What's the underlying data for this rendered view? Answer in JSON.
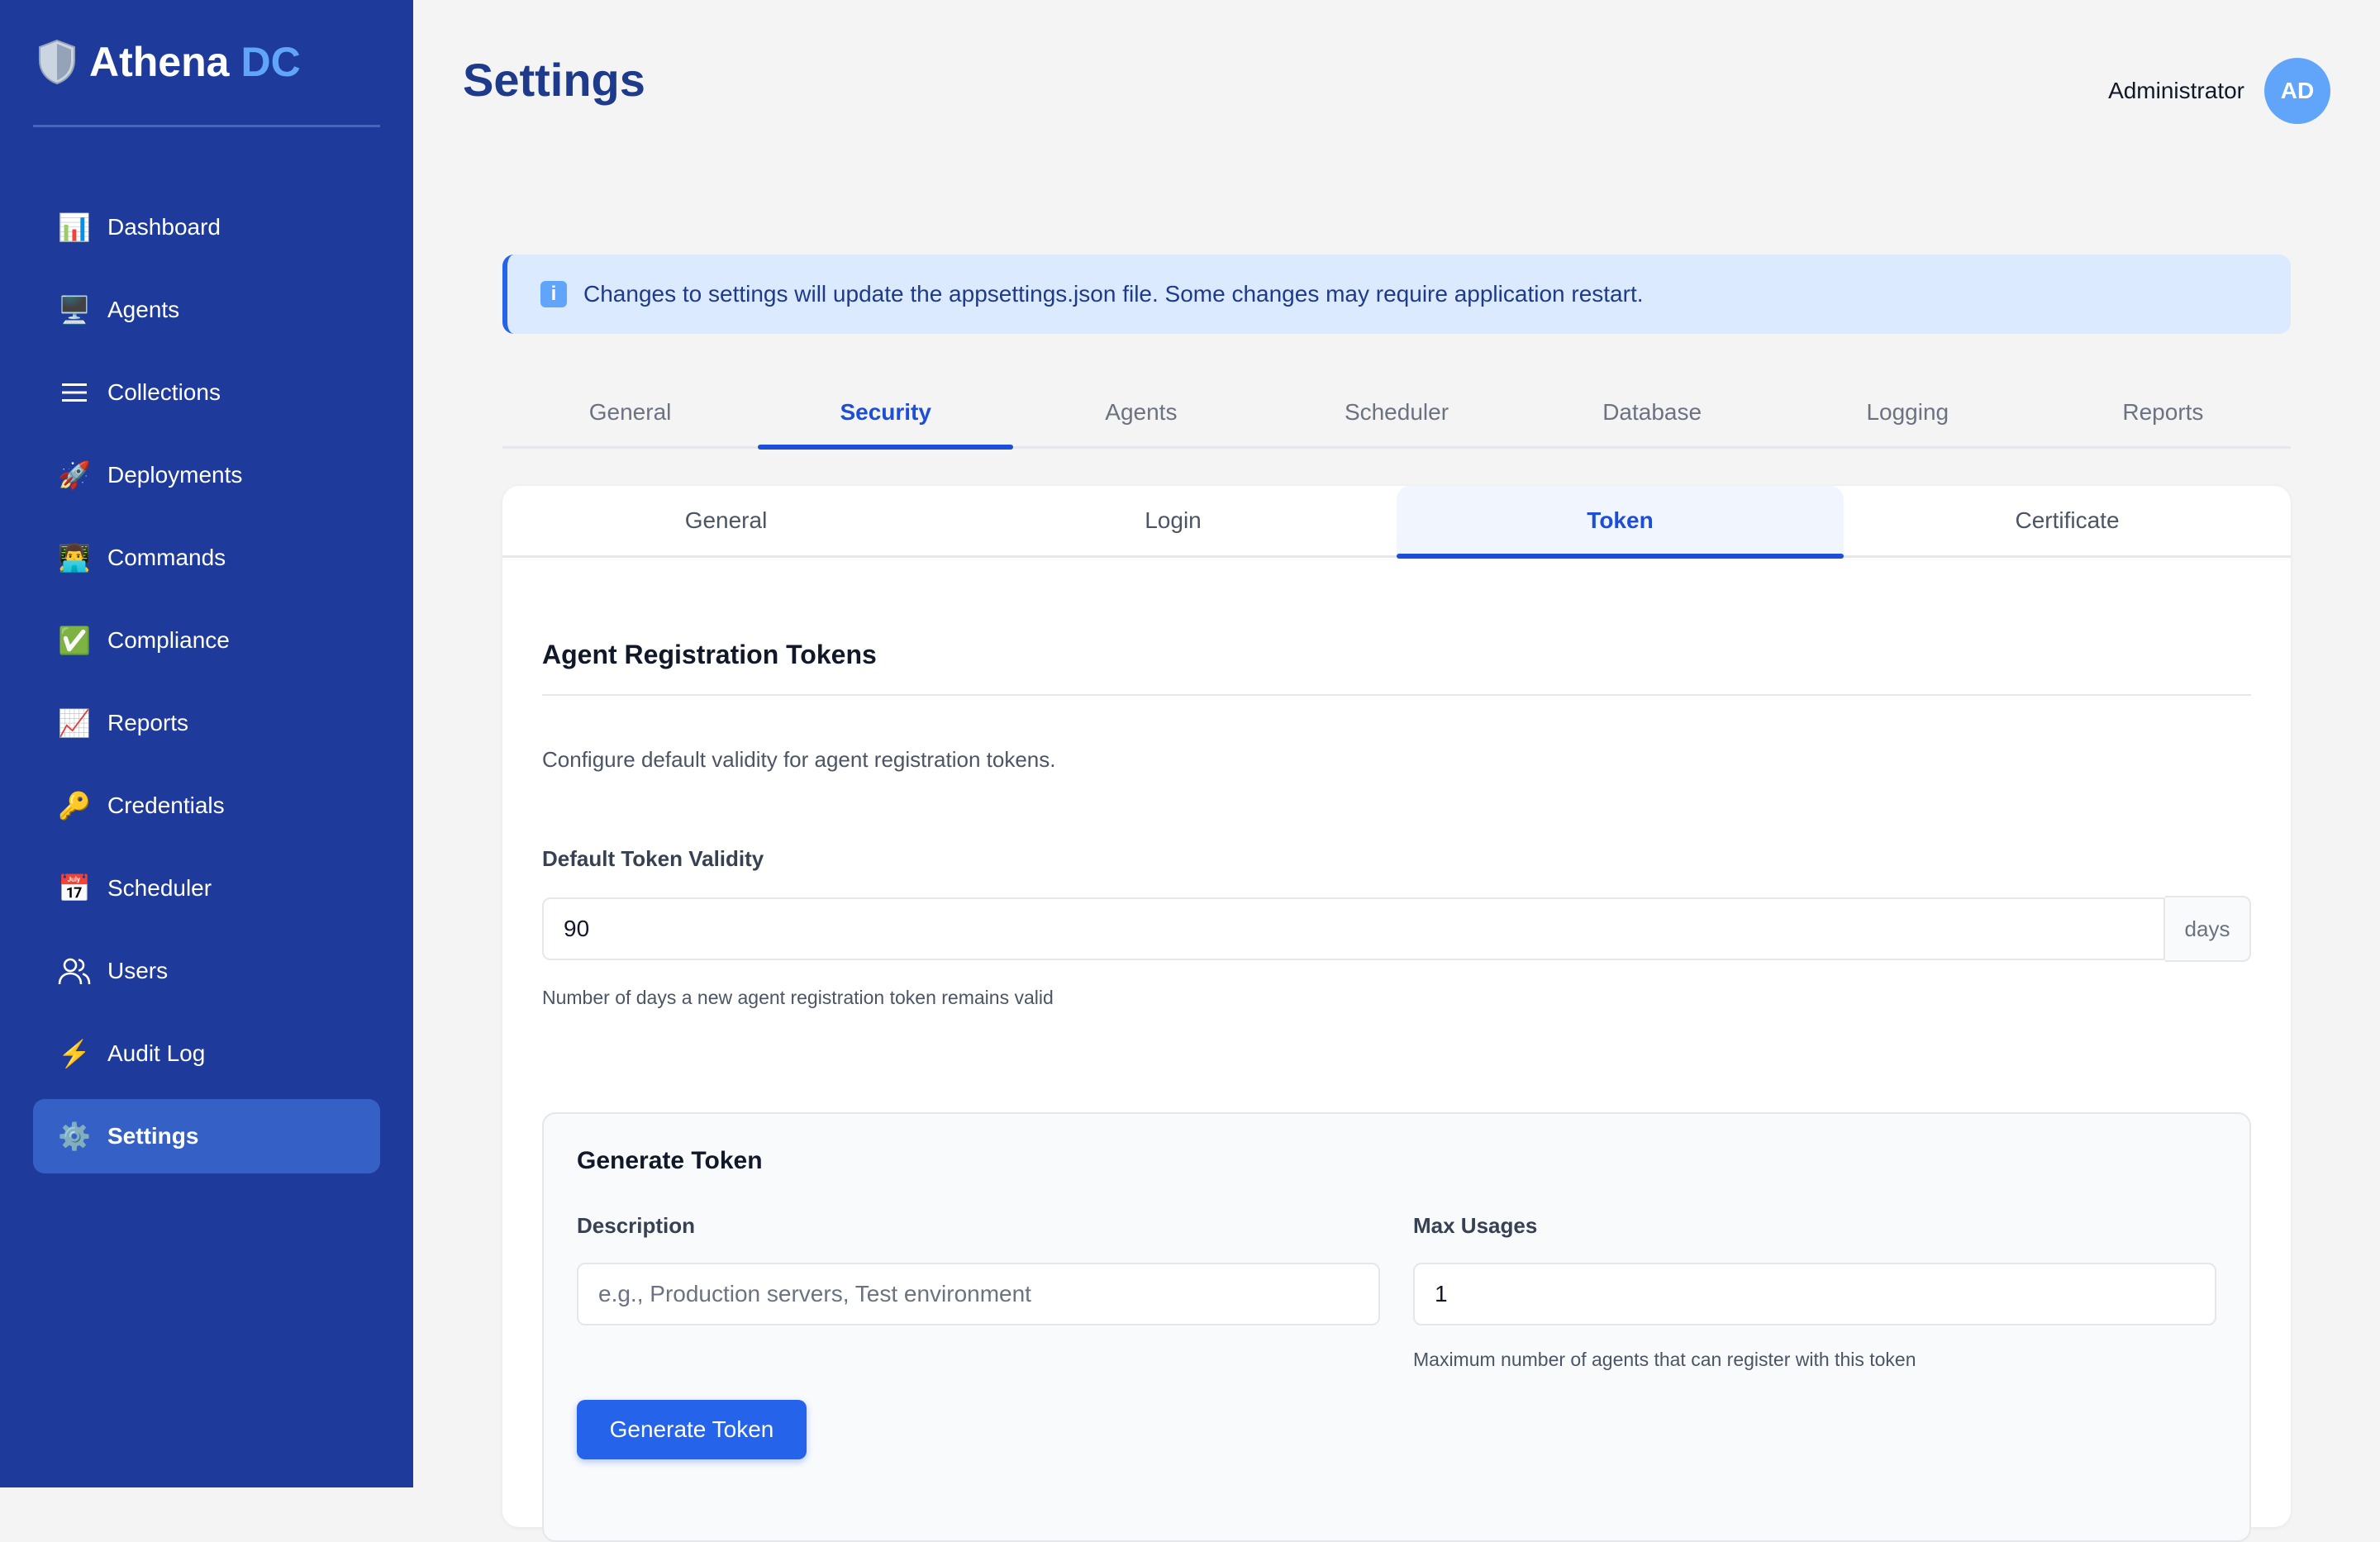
{
  "brand": {
    "name": "Athena",
    "suffix": "DC",
    "icon": "shield-icon"
  },
  "sidebar": {
    "items": [
      {
        "label": "Dashboard",
        "icon": "bar-chart-icon"
      },
      {
        "label": "Agents",
        "icon": "monitor-icon"
      },
      {
        "label": "Collections",
        "icon": "list-icon"
      },
      {
        "label": "Deployments",
        "icon": "rocket-icon"
      },
      {
        "label": "Commands",
        "icon": "technologist-icon"
      },
      {
        "label": "Compliance",
        "icon": "check-box-icon"
      },
      {
        "label": "Reports",
        "icon": "trend-chart-icon"
      },
      {
        "label": "Credentials",
        "icon": "key-icon"
      },
      {
        "label": "Scheduler",
        "icon": "calendar-icon"
      },
      {
        "label": "Users",
        "icon": "users-icon"
      },
      {
        "label": "Audit Log",
        "icon": "lightning-icon"
      },
      {
        "label": "Settings",
        "icon": "gear-icon",
        "active": true
      }
    ]
  },
  "header": {
    "title": "Settings",
    "user": {
      "name": "Administrator",
      "initials": "AD"
    }
  },
  "alert": {
    "icon": "info-icon",
    "text": "Changes to settings will update the appsettings.json file. Some changes may require application restart."
  },
  "tabs": {
    "main": [
      "General",
      "Security",
      "Agents",
      "Scheduler",
      "Database",
      "Logging",
      "Reports"
    ],
    "main_active": "Security",
    "sub": [
      "General",
      "Login",
      "Token",
      "Certificate"
    ],
    "sub_active": "Token"
  },
  "token_section": {
    "title": "Agent Registration Tokens",
    "description": "Configure default validity for agent registration tokens.",
    "validity_label": "Default Token Validity",
    "validity_value": "90",
    "validity_unit": "days",
    "validity_help": "Number of days a new agent registration token remains valid"
  },
  "generate": {
    "title": "Generate Token",
    "description_label": "Description",
    "description_placeholder": "e.g., Production servers, Test environment",
    "description_value": "",
    "max_usages_label": "Max Usages",
    "max_usages_value": "1",
    "max_usages_help": "Maximum number of agents that can register with this token",
    "button_label": "Generate Token"
  },
  "colors": {
    "sidebar_bg": "#1e3a9a",
    "sidebar_active": "#3561c6",
    "accent": "#1d4ed8",
    "brand_accent": "#60a5fa",
    "primary_button": "#2563eb",
    "alert_bg": "#dbeafe"
  }
}
